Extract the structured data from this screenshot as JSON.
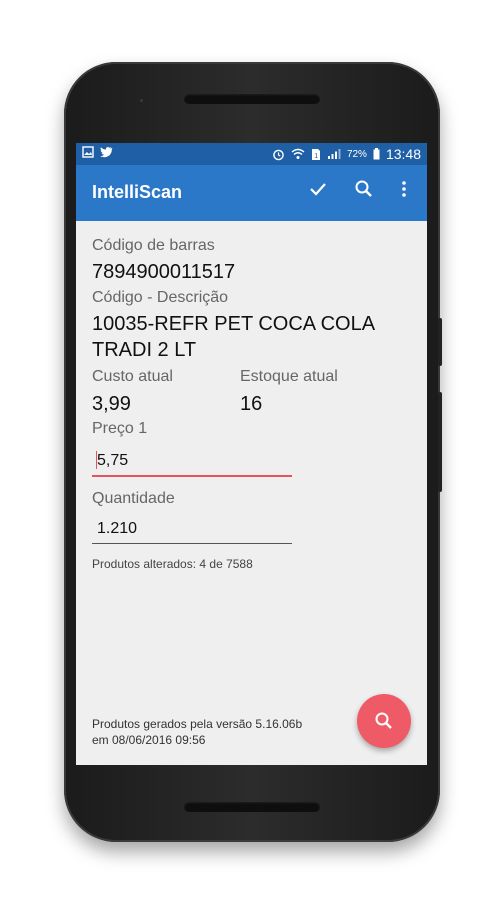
{
  "status_bar": {
    "left_icons": [
      "image-icon",
      "twitter-icon"
    ],
    "battery": "72%",
    "time": "13:48"
  },
  "app_bar": {
    "title": "IntelliScan",
    "actions": [
      "check-icon",
      "search-icon",
      "more-vert-icon"
    ]
  },
  "form": {
    "barcode_label": "Código de barras",
    "barcode_value": "7894900011517",
    "code_desc_label": "Código - Descrição",
    "code_desc_value_line1": "10035-REFR PET COCA COLA",
    "code_desc_value_line2": "TRADI 2 LT",
    "custo_label": "Custo atual",
    "custo_value": "3,99",
    "estoque_label": "Estoque atual",
    "estoque_value": "16",
    "preco_label": "Preço 1",
    "preco_value": "5,75",
    "quantidade_label": "Quantidade",
    "quantidade_value": "1.210",
    "produtos_alterados": "Produtos alterados: 4 de 7588"
  },
  "footer": {
    "line1": "Produtos gerados pela versão 5.16.06b",
    "line2": "em 08/06/2016 09:56"
  },
  "colors": {
    "status_bar": "#1f5fa6",
    "app_bar": "#2b78c8",
    "fab": "#ef5a67",
    "field_focus": "#e8525f"
  }
}
